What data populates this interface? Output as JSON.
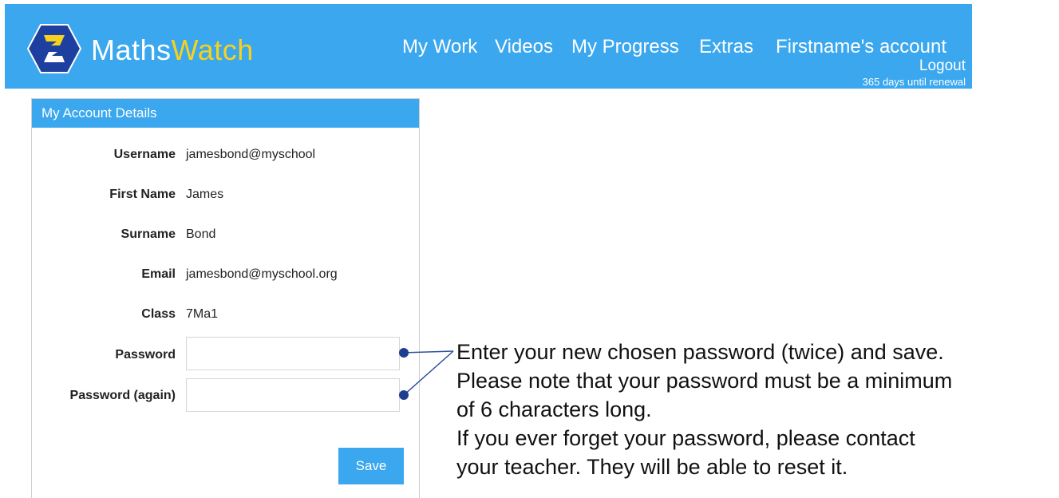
{
  "header": {
    "brand_part1": "Maths",
    "brand_part2": "Watch",
    "nav": [
      "My Work",
      "Videos",
      "My Progress",
      "Extras",
      "Firstname's account"
    ],
    "logout_label": "Logout",
    "renewal_text": "365 days until renewal",
    "colors": {
      "bar": "#3aa7ee",
      "brand_accent": "#f6d21f"
    }
  },
  "panel": {
    "title": "My Account Details",
    "fields": [
      {
        "label": "Username",
        "value": "jamesbond@myschool"
      },
      {
        "label": "First Name",
        "value": "James"
      },
      {
        "label": "Surname",
        "value": "Bond"
      },
      {
        "label": "Email",
        "value": "jamesbond@myschool.org"
      },
      {
        "label": "Class",
        "value": "7Ma1"
      }
    ],
    "password_label": "Password",
    "password_value": "",
    "password_again_label": "Password (again)",
    "password_again_value": "",
    "save_label": "Save"
  },
  "annotation": {
    "lines": [
      "Enter your new chosen password (twice) and save.",
      "Please note that your password must be a minimum",
      "of 6 characters long.",
      "If you ever forget your password, please contact",
      "your teacher. They will be able to reset it."
    ]
  }
}
